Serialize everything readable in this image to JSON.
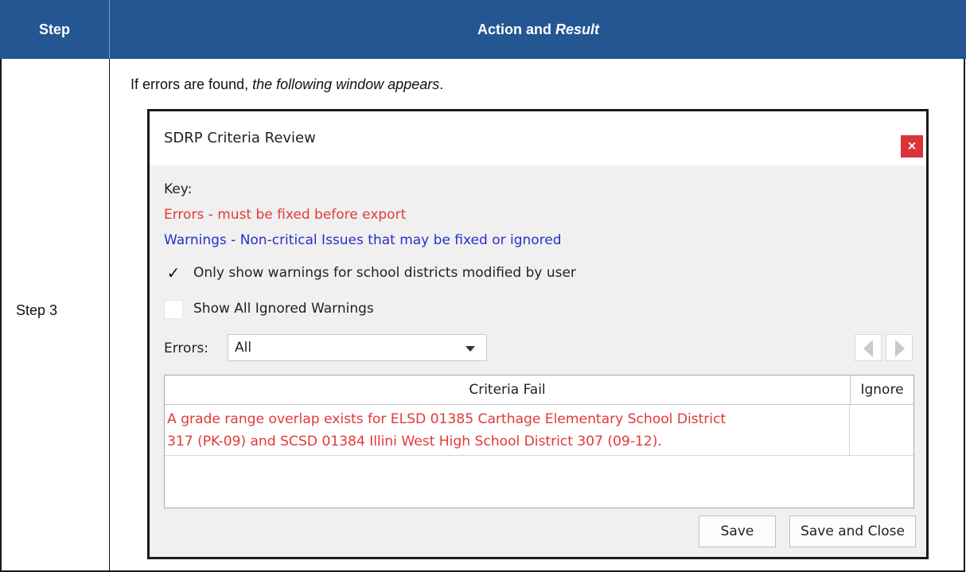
{
  "table": {
    "header_step": "Step",
    "header_action": "Action and ",
    "header_result": "Result",
    "step_label": "Step 3",
    "intro_plain": "If errors are found, ",
    "intro_italic": "the following window appears",
    "intro_end": "."
  },
  "dialog": {
    "title": "SDRP Criteria Review",
    "close_glyph": "×",
    "key_label": "Key:",
    "errors_key": "Errors - must be fixed before export",
    "warnings_key": "Warnings - Non-critical Issues that may be fixed or ignored",
    "checkbox_only_show": {
      "label": "Only show warnings for school districts modified by user",
      "checked_glyph": "✓"
    },
    "checkbox_show_ignored": {
      "label": "Show All Ignored Warnings",
      "checked_glyph": ""
    },
    "errors_filter_label": "Errors:",
    "errors_filter_value": "All",
    "grid": {
      "col_criteria": "Criteria Fail",
      "col_ignore": "Ignore",
      "rows": [
        {
          "criteria_line1": "A grade range overlap exists for ELSD 01385 Carthage Elementary School District",
          "criteria_line2": "317 (PK-09) and SCSD 01384 Illini West High School District 307 (09-12).",
          "ignore": ""
        }
      ]
    },
    "save_label": "Save",
    "save_close_label": "Save and Close"
  },
  "colors": {
    "header_bg": "#245692",
    "error_text": "#e23a3a",
    "warning_text": "#2a2fc9",
    "close_bg": "#d9343a"
  }
}
